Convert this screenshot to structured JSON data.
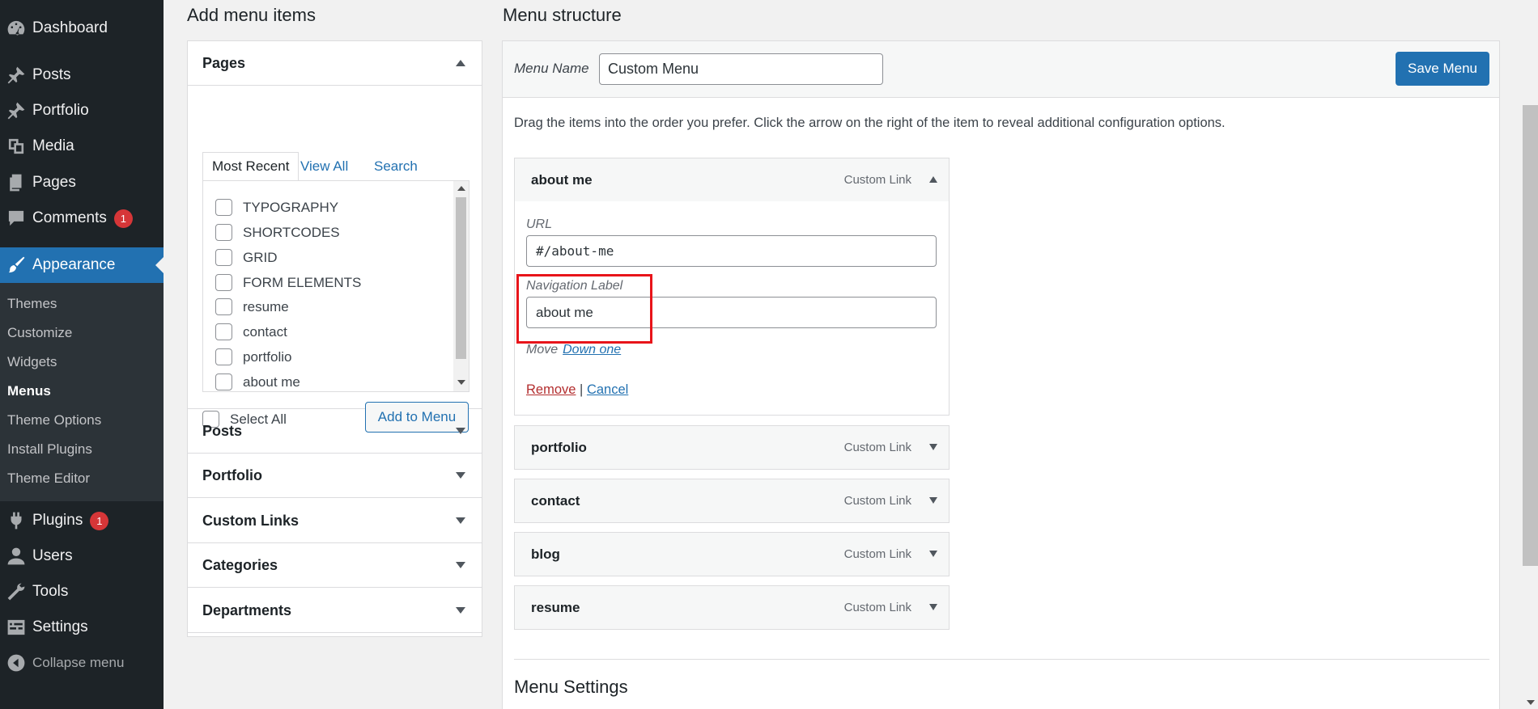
{
  "sidebar": {
    "items": [
      {
        "label": "Dashboard",
        "icon": "dashboard-icon"
      },
      {
        "label": "Posts",
        "icon": "pin-icon"
      },
      {
        "label": "Portfolio",
        "icon": "pin-icon"
      },
      {
        "label": "Media",
        "icon": "media-icon"
      },
      {
        "label": "Pages",
        "icon": "pages-icon"
      },
      {
        "label": "Comments",
        "icon": "comment-icon",
        "badge": "1"
      },
      {
        "label": "Appearance",
        "icon": "paintbrush-icon"
      },
      {
        "label": "Plugins",
        "icon": "plugin-icon",
        "badge": "1"
      },
      {
        "label": "Users",
        "icon": "user-icon"
      },
      {
        "label": "Tools",
        "icon": "wrench-icon"
      },
      {
        "label": "Settings",
        "icon": "settings-icon"
      }
    ],
    "submenu": [
      "Themes",
      "Customize",
      "Widgets",
      "Menus",
      "Theme Options",
      "Install Plugins",
      "Theme Editor"
    ],
    "collapse_label": "Collapse menu",
    "active_color": "#2271b1"
  },
  "left": {
    "title": "Add menu items",
    "pages": {
      "heading": "Pages",
      "tabs": [
        "Most Recent",
        "View All",
        "Search"
      ],
      "items": [
        "TYPOGRAPHY",
        "SHORTCODES",
        "GRID",
        "FORM ELEMENTS",
        "resume",
        "contact",
        "portfolio",
        "about me"
      ],
      "select_all": "Select All",
      "add_button": "Add to Menu"
    },
    "sections": [
      "Posts",
      "Portfolio",
      "Custom Links",
      "Categories",
      "Departments"
    ]
  },
  "right": {
    "title": "Menu structure",
    "menu_name_label": "Menu Name",
    "menu_name_value": "Custom Menu",
    "save_button": "Save Menu",
    "instructions": "Drag the items into the order you prefer. Click the arrow on the right of the item to reveal additional configuration options.",
    "expanded": {
      "title": "about me",
      "type": "Custom Link",
      "url_label": "URL",
      "url_value": "#/about-me",
      "nav_label": "Navigation Label",
      "nav_value": "about me",
      "move_label": "Move",
      "move_link": "Down one",
      "remove": "Remove",
      "separator": "|",
      "cancel": "Cancel"
    },
    "items": [
      {
        "title": "portfolio",
        "type": "Custom Link"
      },
      {
        "title": "contact",
        "type": "Custom Link"
      },
      {
        "title": "blog",
        "type": "Custom Link"
      },
      {
        "title": "resume",
        "type": "Custom Link"
      }
    ],
    "settings_title": "Menu Settings"
  },
  "colors": {
    "primary": "#2271b1",
    "badge": "#d63638",
    "highlight": "#e8141a"
  }
}
